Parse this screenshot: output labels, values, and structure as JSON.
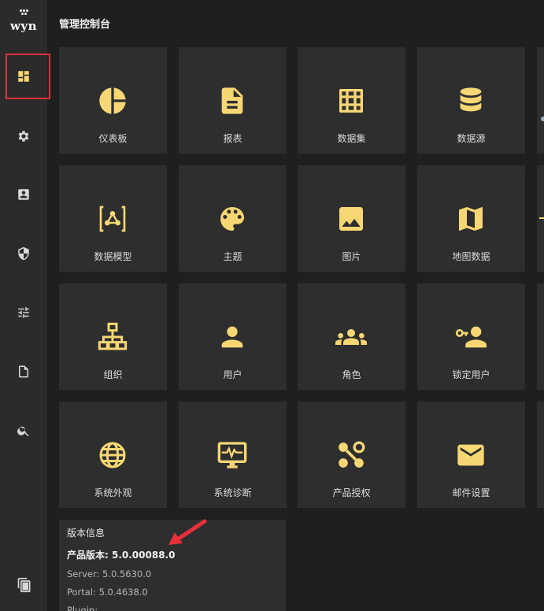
{
  "app": {
    "logo_text": "wyn",
    "title": "管理控制台"
  },
  "sidebar": {
    "items": [
      {
        "id": "dashboard",
        "icon": "dashboard-icon",
        "active": true
      },
      {
        "id": "settings",
        "icon": "gear-icon",
        "active": false
      },
      {
        "id": "account",
        "icon": "account-box-icon",
        "active": false
      },
      {
        "id": "security",
        "icon": "shield-icon",
        "active": false
      },
      {
        "id": "tune",
        "icon": "sliders-icon",
        "active": false
      },
      {
        "id": "document",
        "icon": "document-icon",
        "active": false
      },
      {
        "id": "search",
        "icon": "search-icon",
        "active": false
      },
      {
        "id": "copy",
        "icon": "copy-document-icon",
        "active": false
      }
    ]
  },
  "tiles": [
    {
      "label": "仪表板",
      "icon": "pie-chart-icon"
    },
    {
      "label": "报表",
      "icon": "report-document-icon"
    },
    {
      "label": "数据集",
      "icon": "grid-table-icon"
    },
    {
      "label": "数据源",
      "icon": "database-icon"
    },
    {
      "label": "数据模型",
      "icon": "data-model-icon"
    },
    {
      "label": "主题",
      "icon": "palette-icon"
    },
    {
      "label": "图片",
      "icon": "image-icon"
    },
    {
      "label": "地图数据",
      "icon": "map-icon"
    },
    {
      "label": "组织",
      "icon": "org-tree-icon"
    },
    {
      "label": "用户",
      "icon": "user-icon"
    },
    {
      "label": "角色",
      "icon": "group-icon"
    },
    {
      "label": "锁定用户",
      "icon": "locked-user-icon"
    },
    {
      "label": "系统外观",
      "icon": "globe-icon"
    },
    {
      "label": "系统诊断",
      "icon": "monitor-pulse-icon"
    },
    {
      "label": "产品授权",
      "icon": "license-nodes-icon"
    },
    {
      "label": "邮件设置",
      "icon": "mail-icon"
    }
  ],
  "version": {
    "title": "版本信息",
    "product": "产品版本: 5.0.00088.0",
    "server": "Server: 5.0.5630.0",
    "portal": "Portal: 5.0.4638.0",
    "cut_line": "Plugin:"
  },
  "colors": {
    "accent": "#f7d774",
    "highlight": "#e0303a",
    "arrow": "#e8303a"
  }
}
